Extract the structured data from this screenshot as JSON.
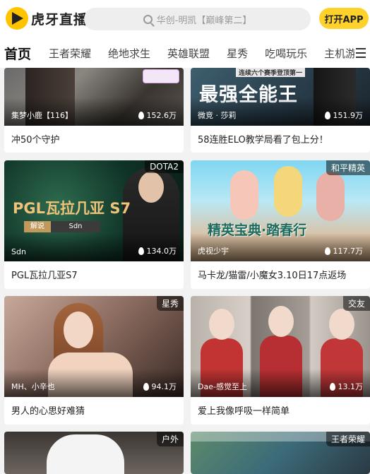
{
  "header": {
    "logo_text": "虎牙直播",
    "search_placeholder": "华创-明凯【巅峰第二】",
    "open_app_label": "打开APP"
  },
  "nav": {
    "items": [
      "首页",
      "王者荣耀",
      "绝地求生",
      "英雄联盟",
      "星秀",
      "吃喝玩乐",
      "主机游戏"
    ]
  },
  "cards": [
    {
      "streamer": "集梦小鹿【116】",
      "views": "152.6万",
      "title": "冲50个守护",
      "tag": ""
    },
    {
      "streamer": "微竞 · 莎莉",
      "views": "151.9万",
      "title": "58连胜ELO教学局看了包上分！",
      "tag": "",
      "overlay_top": "连续六个赛季登顶第一",
      "overlay_main": "最强全能王"
    },
    {
      "streamer": "Sdn",
      "views": "134.0万",
      "title": "PGL瓦拉几亚S7",
      "tag": "DOTA2",
      "overlay_main": "PGL瓦拉几亚 S7",
      "overlay_sub1": "解说",
      "overlay_sub2": "Sdn"
    },
    {
      "streamer": "虎视少宇",
      "views": "117.7万",
      "title": "马卡龙/猫雷/小魔女3.10日17点返场",
      "tag": "和平精英",
      "overlay_main": "精英宝典·踏春行"
    },
    {
      "streamer": "MH、小辛也",
      "views": "94.1万",
      "title": "男人的心思好难猜",
      "tag": "星秀"
    },
    {
      "streamer": "Dae-感觉至上",
      "views": "13.1万",
      "title": "爱上我像呼吸一样简单",
      "tag": "交友"
    },
    {
      "streamer": "",
      "views": "",
      "title": "",
      "tag": "户外"
    },
    {
      "streamer": "",
      "views": "",
      "title": "",
      "tag": "王者荣耀"
    }
  ],
  "colors": {
    "accent": "#ffd12b",
    "logo": "#ffc300"
  }
}
